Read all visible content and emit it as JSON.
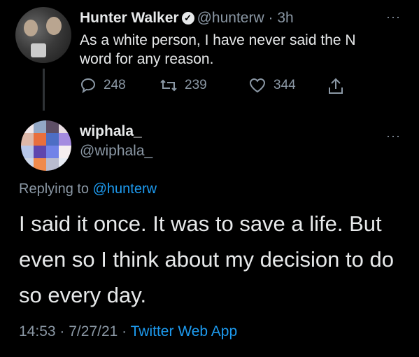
{
  "parent_tweet": {
    "author_name": "Hunter Walker",
    "author_handle": "@hunterw",
    "separator": "·",
    "time_ago": "3h",
    "text": "As a white person, I have never said the N word for any reason.",
    "verified": true,
    "replies": "248",
    "retweets": "239",
    "likes": "344",
    "more_label": "···"
  },
  "reply_tweet": {
    "author_name": "wiphala_",
    "author_handle": "@wiphala_",
    "replying_prefix": "Replying to",
    "replying_to": "@hunterw",
    "text": "I said it once. It was to save a life. But even so I think about my decision to do so every day.",
    "time": "14:53",
    "date": "7/27/21",
    "source": "Twitter Web App",
    "more_label": "···"
  },
  "avatar_mosaic": [
    "#f0e6e9",
    "#93a8c6",
    "#5e4f66",
    "#e9dde3",
    "#ddb8a9",
    "#e86f3d",
    "#4d6ec4",
    "#a58be0",
    "#b7c7ea",
    "#5f46ad",
    "#7183e8",
    "#f6eef0",
    "#ccd6e8",
    "#f08a4b",
    "#b9bccf",
    "#e8ecf5"
  ],
  "colors": {
    "background": "#000000",
    "text": "#e7e9ea",
    "muted": "#8b98a5",
    "link": "#1d9bf0"
  }
}
